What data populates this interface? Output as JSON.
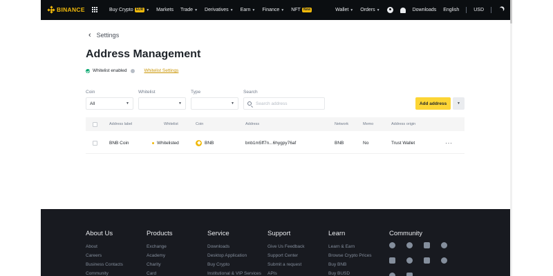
{
  "brand": {
    "name": "BINANCE",
    "color": "#f0b90b"
  },
  "nav": {
    "items": [
      {
        "label": "Buy Crypto",
        "badge": "EUR",
        "dropdown": true
      },
      {
        "label": "Markets",
        "dropdown": false
      },
      {
        "label": "Trade",
        "dropdown": true
      },
      {
        "label": "Derivatives",
        "dropdown": true
      },
      {
        "label": "Earn",
        "dropdown": true
      },
      {
        "label": "Finance",
        "dropdown": true
      },
      {
        "label": "NFT",
        "badge": "New",
        "dropdown": false
      }
    ],
    "right": {
      "wallet": "Wallet",
      "orders": "Orders",
      "downloads": "Downloads",
      "language": "English",
      "currency": "USD"
    }
  },
  "breadcrumb": {
    "back_label": "Settings"
  },
  "page": {
    "title": "Address Management"
  },
  "whitelist": {
    "status": "Whitelist enabled",
    "settings_link": "Whitelist Settings"
  },
  "filters": {
    "coin": {
      "label": "Coin",
      "value": "All"
    },
    "whitelist": {
      "label": "Whitelist",
      "value": ""
    },
    "type": {
      "label": "Type",
      "value": ""
    },
    "search": {
      "label": "Search",
      "placeholder": "Search address"
    }
  },
  "actions": {
    "add_address": "Add address"
  },
  "table": {
    "columns": [
      "Address label",
      "Whitelist",
      "Coin",
      "Address",
      "Network",
      "Memo",
      "Address origin"
    ],
    "rows": [
      {
        "label": "BNB Coin",
        "whitelist": "Whitelisted",
        "coin": "BNB",
        "address": "bnb1m5ff7n...6hygpy76af",
        "network": "BNB",
        "memo": "No",
        "origin": "Trust Wallet",
        "more": "···"
      }
    ]
  },
  "footer": {
    "columns": [
      {
        "title": "About Us",
        "links": [
          "About",
          "Careers",
          "Business Contacts",
          "Community"
        ]
      },
      {
        "title": "Products",
        "links": [
          "Exchange",
          "Academy",
          "Charity",
          "Card"
        ]
      },
      {
        "title": "Service",
        "links": [
          "Downloads",
          "Desktop Application",
          "Buy Crypto",
          "Institutional & VIP Services"
        ]
      },
      {
        "title": "Support",
        "links": [
          "Give Us Feedback",
          "Support Center",
          "Submit a request",
          "APIs"
        ]
      },
      {
        "title": "Learn",
        "links": [
          "Learn & Earn",
          "Browse Crypto Prices",
          "Buy BNB",
          "Buy BUSD"
        ]
      },
      {
        "title": "Community",
        "links": []
      }
    ],
    "social_icons": [
      "discord-icon",
      "telegram-icon",
      "tiktok-icon",
      "facebook-icon",
      "twitter-icon",
      "reddit-icon",
      "instagram-icon",
      "coinmarketcap-icon",
      "vk-icon",
      "youtube-icon"
    ]
  }
}
